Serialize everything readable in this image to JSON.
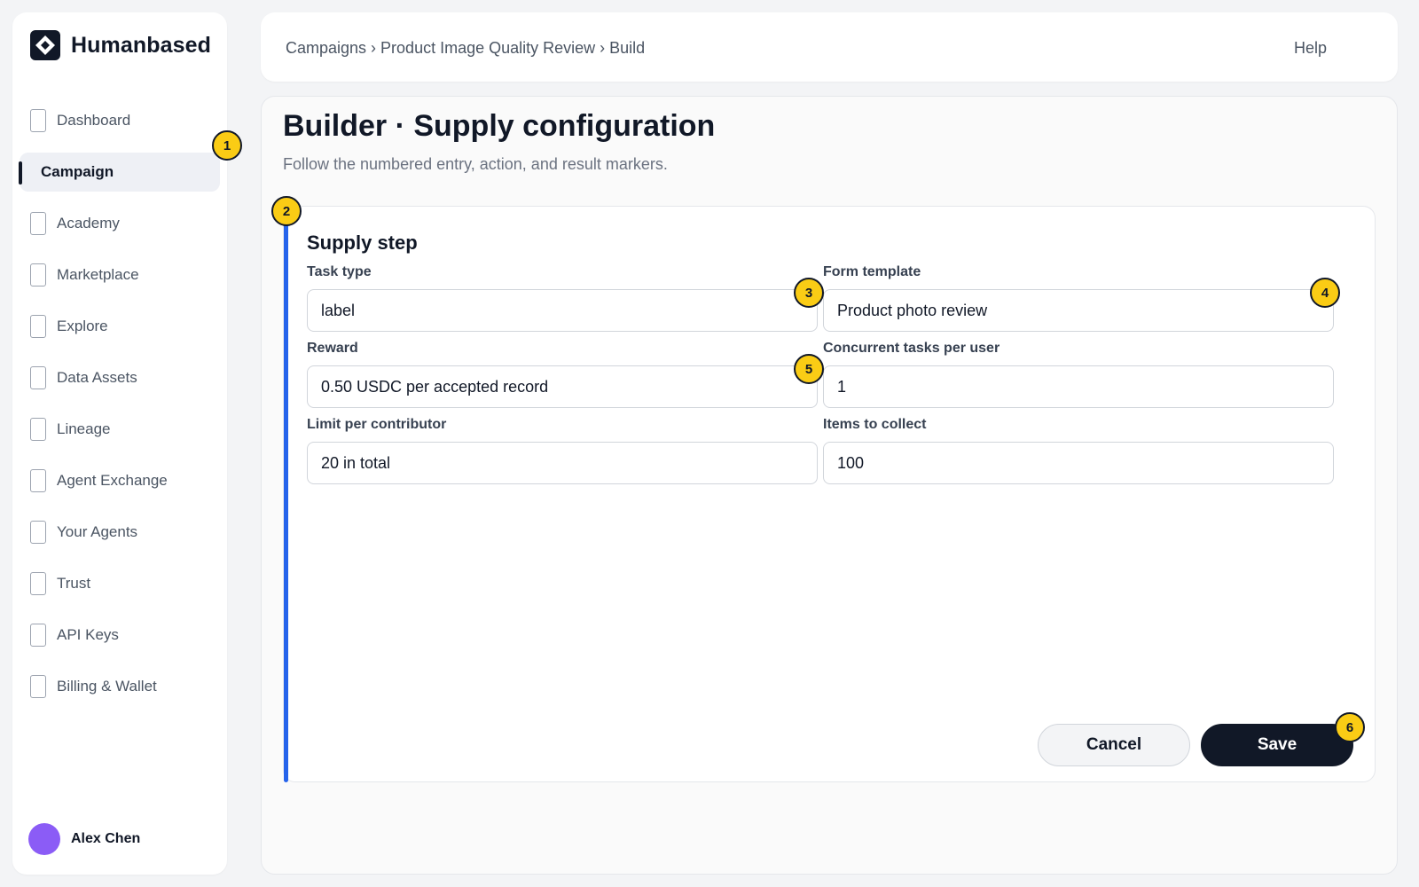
{
  "brand": {
    "name": "Humanbased",
    "logo_icon": "diamond-logo-icon"
  },
  "sidebar": {
    "items": [
      {
        "label": "Dashboard",
        "active": false
      },
      {
        "label": "Campaign",
        "active": true
      },
      {
        "label": "Academy",
        "active": false
      },
      {
        "label": "Marketplace",
        "active": false
      },
      {
        "label": "Explore",
        "active": false
      },
      {
        "label": "Data Assets",
        "active": false
      },
      {
        "label": "Lineage",
        "active": false
      },
      {
        "label": "Agent Exchange",
        "active": false
      },
      {
        "label": "Your Agents",
        "active": false
      },
      {
        "label": "Trust",
        "active": false
      },
      {
        "label": "API Keys",
        "active": false
      },
      {
        "label": "Billing & Wallet",
        "active": false
      }
    ],
    "user": {
      "name": "Alex Chen",
      "avatar_color": "#8b5cf6"
    }
  },
  "header": {
    "breadcrumb": "Campaigns › Product Image Quality Review › Build",
    "help_label": "Help"
  },
  "page": {
    "title": "Builder · Supply configuration",
    "subtitle": "Follow the numbered entry, action, and result markers."
  },
  "card": {
    "title": "Supply step",
    "accent_color": "#2563eb",
    "fields": {
      "task_type": {
        "label": "Task type",
        "value": "label"
      },
      "form_template": {
        "label": "Form template",
        "value": "Product photo review"
      },
      "reward": {
        "label": "Reward",
        "value": "0.50 USDC per accepted record"
      },
      "concurrent_tasks": {
        "label": "Concurrent tasks per user",
        "value": "1"
      },
      "limit_per_contributor": {
        "label": "Limit per contributor",
        "value": "20 in total"
      },
      "items_to_collect": {
        "label": "Items to collect",
        "value": "100"
      }
    },
    "actions": {
      "cancel_label": "Cancel",
      "save_label": "Save"
    }
  },
  "markers": [
    "1",
    "2",
    "3",
    "4",
    "5",
    "6"
  ],
  "colors": {
    "marker": "#facc15",
    "primary": "#111827",
    "accent": "#2563eb"
  }
}
